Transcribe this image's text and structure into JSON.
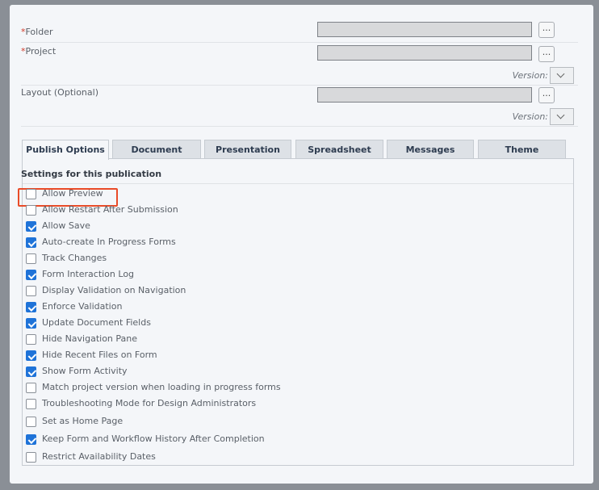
{
  "form": {
    "folder_label": "Folder",
    "project_label": "Project",
    "layout_label": "Layout (Optional)",
    "browse_label": "...",
    "version_label": "Version:"
  },
  "tabs": [
    {
      "label": "Publish Options",
      "active": true
    },
    {
      "label": "Document",
      "active": false
    },
    {
      "label": "Presentation",
      "active": false
    },
    {
      "label": "Spreadsheet",
      "active": false
    },
    {
      "label": "Messages",
      "active": false
    },
    {
      "label": "Theme",
      "active": false
    }
  ],
  "settings": {
    "title": "Settings for this publication",
    "options": [
      {
        "label": "Allow Preview",
        "checked": false,
        "highlighted": true
      },
      {
        "label": "Allow Restart After Submission",
        "checked": false
      },
      {
        "label": "Allow Save",
        "checked": true
      },
      {
        "label": "Auto-create In Progress Forms",
        "checked": true
      },
      {
        "label": "Track Changes",
        "checked": false
      },
      {
        "label": "Form Interaction Log",
        "checked": true
      },
      {
        "label": "Display Validation on Navigation",
        "checked": false
      },
      {
        "label": "Enforce Validation",
        "checked": true
      },
      {
        "label": "Update Document Fields",
        "checked": true
      },
      {
        "label": "Hide Navigation Pane",
        "checked": false
      },
      {
        "label": "Hide Recent Files on Form",
        "checked": true
      },
      {
        "label": "Show Form Activity",
        "checked": true
      },
      {
        "label": "Match project version when loading in progress forms",
        "checked": false
      },
      {
        "label": "Troubleshooting Mode for Design Administrators",
        "checked": false
      },
      {
        "label": "Set as Home Page",
        "checked": false
      },
      {
        "label": "Keep Form and Workflow History After Completion",
        "checked": true
      },
      {
        "label": "Restrict Availability Dates",
        "checked": false
      }
    ]
  },
  "colors": {
    "accent_checkbox": "#1f73d8",
    "highlight_border": "#e94b28",
    "required_mark": "#d23b2a"
  }
}
